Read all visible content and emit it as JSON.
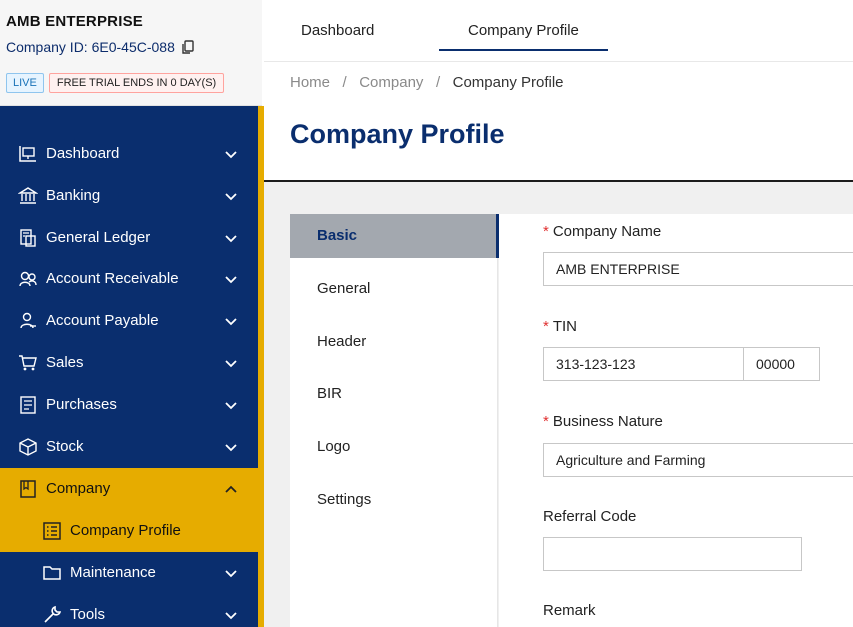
{
  "company": {
    "name": "AMB ENTERPRISE",
    "id_text": "Company ID: 6E0-45C-088",
    "badge_live": "LIVE",
    "badge_trial": "FREE TRIAL ENDS IN 0 DAY(S)"
  },
  "sidebar": {
    "items": [
      {
        "label": "Dashboard"
      },
      {
        "label": "Banking"
      },
      {
        "label": "General Ledger"
      },
      {
        "label": "Account Receivable"
      },
      {
        "label": "Account Payable"
      },
      {
        "label": "Sales"
      },
      {
        "label": "Purchases"
      },
      {
        "label": "Stock"
      },
      {
        "label": "Company"
      },
      {
        "label": "Company Profile"
      },
      {
        "label": "Maintenance"
      },
      {
        "label": "Tools"
      }
    ]
  },
  "tabs": [
    {
      "label": "Dashboard"
    },
    {
      "label": "Company Profile"
    }
  ],
  "breadcrumb": {
    "home": "Home",
    "sep": "/",
    "company": "Company",
    "current": "Company Profile"
  },
  "page": {
    "title": "Company Profile"
  },
  "subnav": [
    {
      "label": "Basic"
    },
    {
      "label": "General"
    },
    {
      "label": "Header"
    },
    {
      "label": "BIR"
    },
    {
      "label": "Logo"
    },
    {
      "label": "Settings"
    }
  ],
  "form": {
    "company_name": {
      "label": "Company Name",
      "value": "AMB ENTERPRISE"
    },
    "tin": {
      "label": "TIN",
      "value": "313-123-123",
      "branch": "00000"
    },
    "business_nature": {
      "label": "Business Nature",
      "value": "Agriculture and Farming"
    },
    "referral_code": {
      "label": "Referral Code",
      "value": ""
    },
    "remark": {
      "label": "Remark"
    },
    "required_marker": "*"
  },
  "colors": {
    "navy": "#0a2e6e",
    "accent": "#e6ac00"
  }
}
